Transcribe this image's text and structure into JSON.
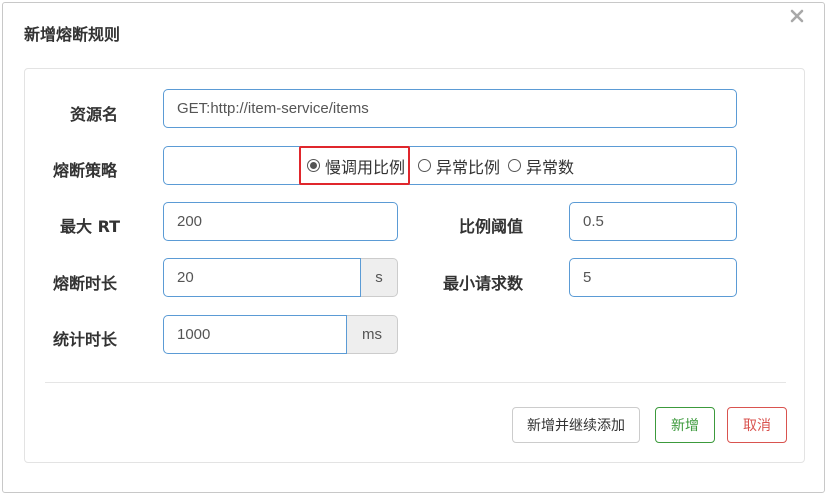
{
  "dialog": {
    "title": "新增熔断规则",
    "close_icon": "close-icon"
  },
  "form": {
    "resource": {
      "label": "资源名",
      "value": "GET:http://item-service/items"
    },
    "strategy": {
      "label": "熔断策略",
      "options": [
        "慢调用比例",
        "异常比例",
        "异常数"
      ],
      "selected": "慢调用比例"
    },
    "max_rt": {
      "label": "最大 RT",
      "value": "200"
    },
    "ratio_threshold": {
      "label": "比例阈值",
      "value": "0.5"
    },
    "break_duration": {
      "label": "熔断时长",
      "value": "20",
      "unit": "s"
    },
    "min_requests": {
      "label": "最小请求数",
      "value": "5"
    },
    "stat_duration": {
      "label": "统计时长",
      "value": "1000",
      "unit": "ms"
    }
  },
  "footer": {
    "add_continue_label": "新增并继续添加",
    "add_label": "新增",
    "cancel_label": "取消"
  },
  "colors": {
    "input_border": "#5b9bd5",
    "highlight": "#e0262c",
    "add_green": "#3c9a3c",
    "cancel_red": "#d9534f"
  }
}
